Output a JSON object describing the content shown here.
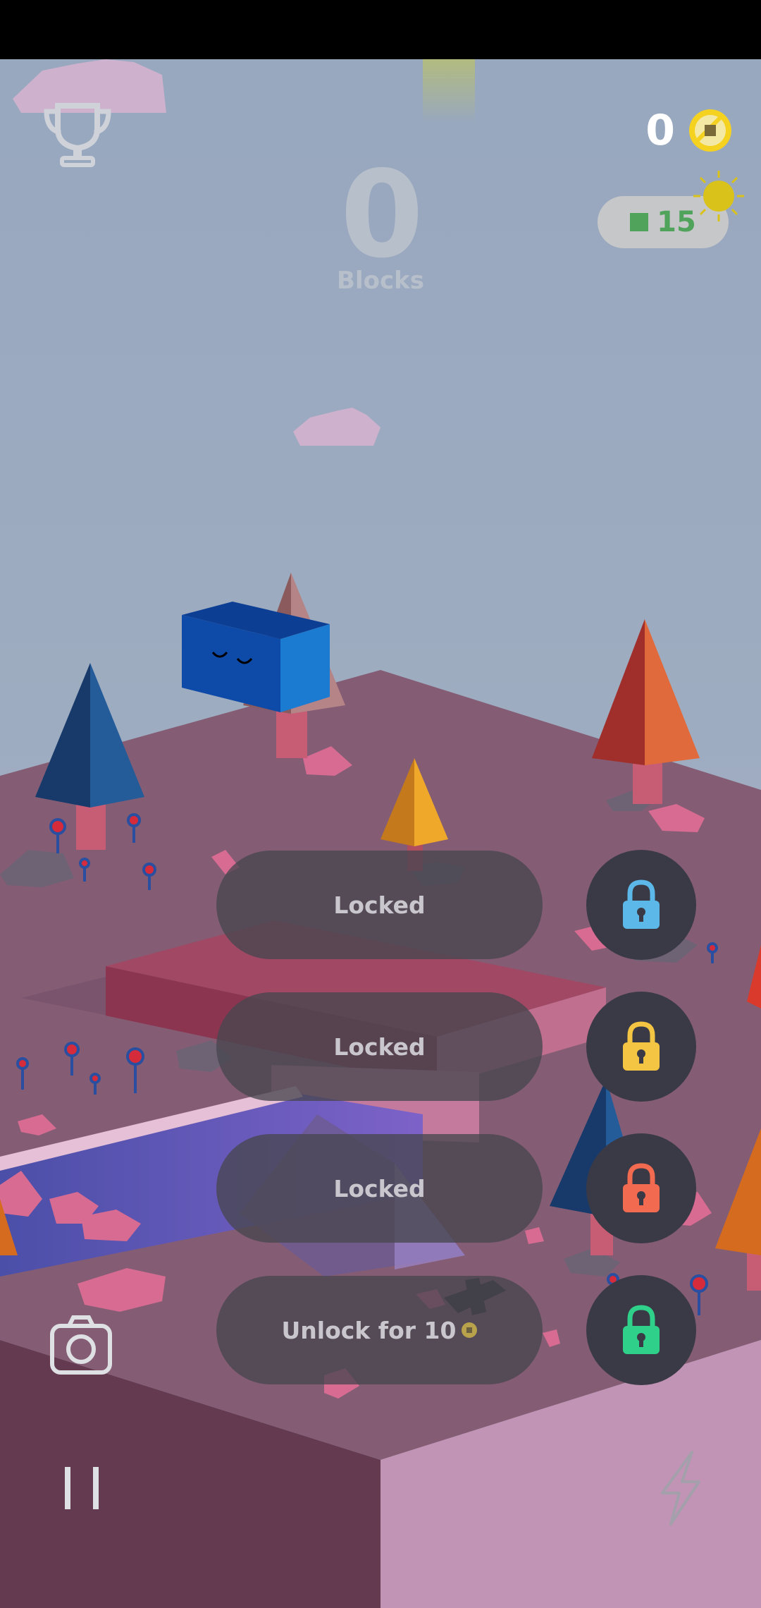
{
  "hud": {
    "coin_count": "0",
    "score_value": "0",
    "score_label": "Blocks",
    "blocks_count": "15"
  },
  "skins": [
    {
      "label": "Locked",
      "lock_color": "#5bb8e8"
    },
    {
      "label": "Locked",
      "lock_color": "#f4c542"
    },
    {
      "label": "Locked",
      "lock_color": "#f26a4f"
    },
    {
      "label": "Unlock for 10",
      "lock_color": "#2fd08a"
    }
  ],
  "icons": [
    "trophy-icon",
    "coin-icon",
    "sun-icon",
    "lock-icon",
    "camera-icon",
    "pause-icon",
    "lightning-icon"
  ]
}
